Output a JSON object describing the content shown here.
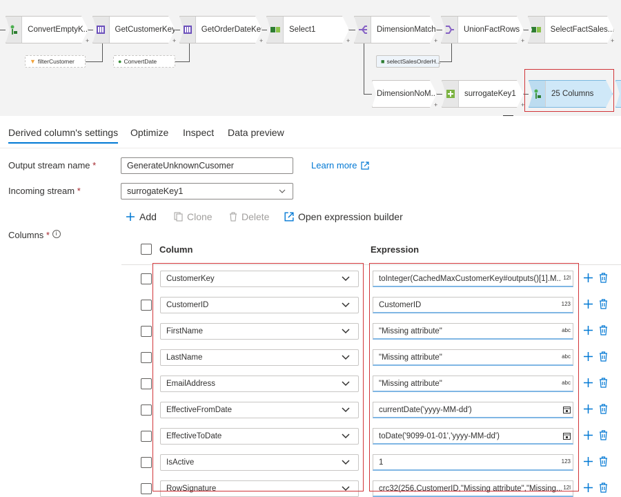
{
  "flow": {
    "nodes": [
      {
        "label": "ConvertEmptyK...",
        "icon": "derived-column-icon"
      },
      {
        "label": "GetCustomerKey",
        "icon": "lookup-icon"
      },
      {
        "label": "GetOrderDateKey",
        "icon": "lookup-icon"
      },
      {
        "label": "Select1",
        "icon": "select-icon"
      },
      {
        "label": "DimensionMatch",
        "icon": "split-icon"
      },
      {
        "label": "UnionFactRows",
        "icon": "union-icon"
      },
      {
        "label": "SelectFactSales...",
        "icon": "select-icon"
      },
      {
        "label": "DimensionNoM...",
        "icon": ""
      },
      {
        "label": "surrogateKey1",
        "icon": "surrogate-key-icon"
      },
      {
        "label": "25 Columns",
        "icon": "derived-column-icon"
      }
    ],
    "chips": [
      {
        "label": "filterCustomer"
      },
      {
        "label": "ConvertDate"
      },
      {
        "label": "selectSalesOrderH..."
      }
    ]
  },
  "tabs": [
    {
      "label": "Derived column's settings",
      "active": true
    },
    {
      "label": "Optimize",
      "active": false
    },
    {
      "label": "Inspect",
      "active": false
    },
    {
      "label": "Data preview",
      "active": false
    }
  ],
  "form": {
    "output_stream_label": "Output stream name",
    "output_stream_value": "GenerateUnknownCusomer",
    "learn_more": "Learn more",
    "incoming_stream_label": "Incoming stream",
    "incoming_stream_value": "surrogateKey1",
    "columns_label": "Columns",
    "required_mark": "*"
  },
  "toolbar": {
    "add": "Add",
    "clone": "Clone",
    "delete": "Delete",
    "open_builder": "Open expression builder"
  },
  "table": {
    "col_header": "Column",
    "expr_header": "Expression",
    "rows": [
      {
        "column": "CustomerKey",
        "expression": "toInteger(CachedMaxCustomerKey#outputs()[1].M...",
        "type": "12l"
      },
      {
        "column": "CustomerID",
        "expression": "CustomerID",
        "type": "123"
      },
      {
        "column": "FirstName",
        "expression": "\"Missing attribute\"",
        "type": "abc"
      },
      {
        "column": "LastName",
        "expression": "\"Missing attribute\"",
        "type": "abc"
      },
      {
        "column": "EmailAddress",
        "expression": "\"Missing attribute\"",
        "type": "abc"
      },
      {
        "column": "EffectiveFromDate",
        "expression": "currentDate('yyyy-MM-dd')",
        "type": "calendar"
      },
      {
        "column": "EffectiveToDate",
        "expression": "toDate('9099-01-01','yyyy-MM-dd')",
        "type": "calendar"
      },
      {
        "column": "IsActive",
        "expression": "1",
        "type": "123"
      },
      {
        "column": "RowSignature",
        "expression": "crc32(256,CustomerID,\"Missing attribute\",\"Missing...",
        "type": "12l"
      }
    ]
  },
  "colors": {
    "accent": "#0078d4",
    "highlight": "#d13438",
    "selected_node": "#cfe8f8"
  }
}
